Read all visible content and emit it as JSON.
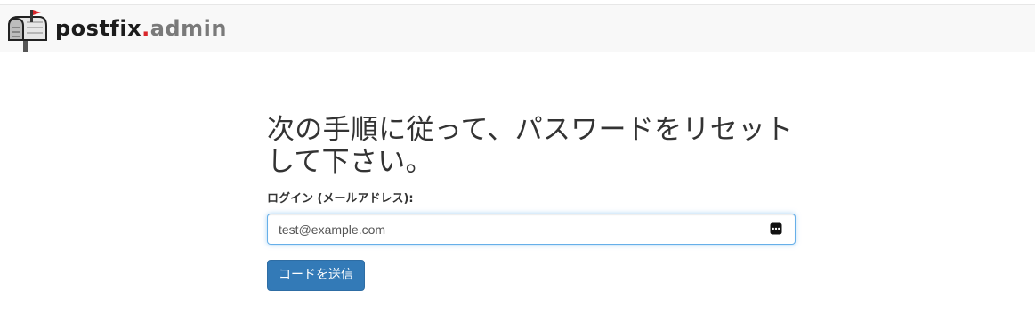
{
  "header": {
    "brand_part1": "postfix",
    "brand_part2": ".",
    "brand_part3": "admin",
    "logo_icon": "mailbox-icon"
  },
  "form": {
    "heading": "次の手順に従って、パスワードをリセットして下さい。",
    "login_label": "ログイン (メールアドレス):",
    "login_value": "test@example.com",
    "submit_label": "コードを送信",
    "password_manager_icon": "password-manager-icon"
  },
  "colors": {
    "brand_dot": "#d9262b",
    "brand_admin": "#7a7a7a",
    "button_primary": "#337ab7",
    "input_focus": "#66afe9"
  }
}
